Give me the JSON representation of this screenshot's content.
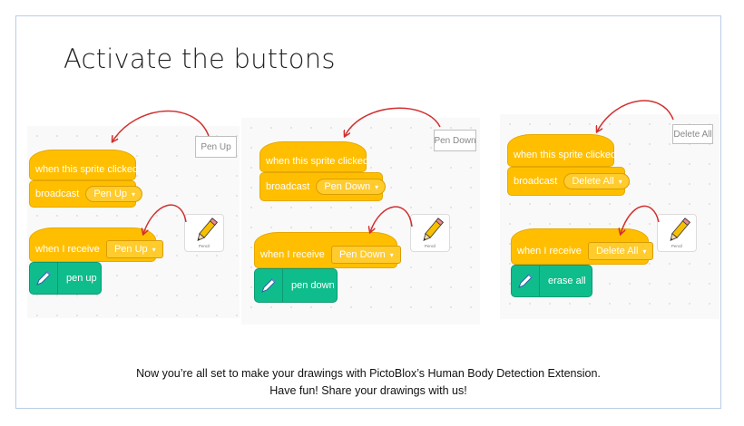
{
  "slide": {
    "title": "Activate the buttons",
    "footer_line1": "Now you’re all set to make your drawings with PictoBlox’s Human Body Detection Extension.",
    "footer_line2": "Have fun! Share your drawings with us!"
  },
  "blocks": {
    "hat_label": "when this sprite clicked",
    "broadcast_label": "broadcast",
    "receive_label": "when I receive",
    "caret": "▾"
  },
  "panels": [
    {
      "button_label": "Pen Up",
      "message": "Pen Up",
      "action": "pen up",
      "sprite_name": "Pencil"
    },
    {
      "button_label": "Pen Down",
      "message": "Pen Down",
      "action": "pen down",
      "sprite_name": "Pencil"
    },
    {
      "button_label": "Delete All",
      "message": "Delete All",
      "action": "erase all",
      "sprite_name": "Pencil"
    }
  ],
  "colors": {
    "events": "#ffbf00",
    "pen": "#0fbd8c",
    "arrow": "#d32f2f"
  },
  "icons": {
    "pen_block_icon": "pen-icon",
    "sprite_icon": "pencil-icon"
  }
}
